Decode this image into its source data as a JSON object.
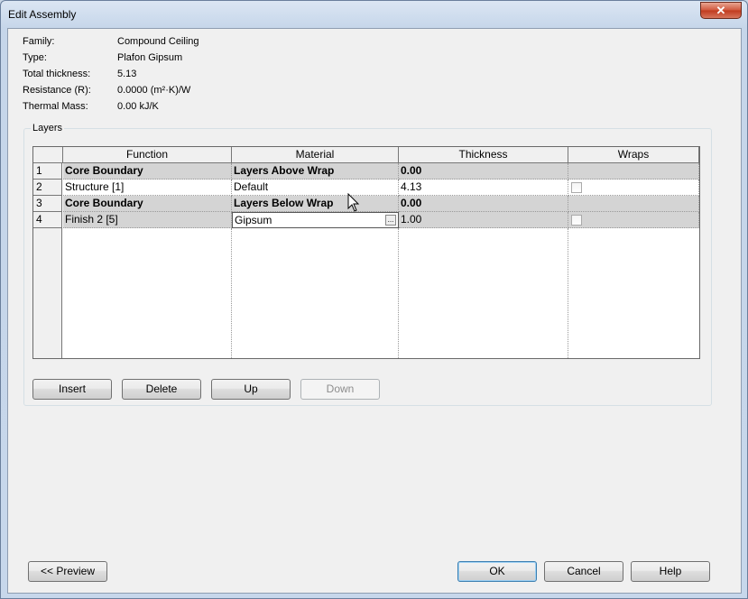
{
  "window": {
    "title": "Edit Assembly",
    "close_glyph": "✕"
  },
  "properties": [
    {
      "label": "Family:",
      "value": "Compound Ceiling"
    },
    {
      "label": "Type:",
      "value": "Plafon Gipsum"
    },
    {
      "label": "Total thickness:",
      "value": "5.13"
    },
    {
      "label": "Resistance (R):",
      "value": "0.0000 (m²·K)/W"
    },
    {
      "label": "Thermal Mass:",
      "value": "0.00 kJ/K"
    }
  ],
  "layers": {
    "group_label": "Layers",
    "columns": [
      "Function",
      "Material",
      "Thickness",
      "Wraps"
    ],
    "rows": [
      {
        "num": "1",
        "function": "Core Boundary",
        "material": "Layers Above Wrap",
        "thickness": "0.00",
        "wraps": null
      },
      {
        "num": "2",
        "function": "Structure [1]",
        "material": "Default",
        "thickness": "4.13",
        "wraps": false
      },
      {
        "num": "3",
        "function": "Core Boundary",
        "material": "Layers Below Wrap",
        "thickness": "0.00",
        "wraps": null
      },
      {
        "num": "4",
        "function": "Finish 2 [5]",
        "material": "Gipsum",
        "thickness": "1.00",
        "wraps": false
      }
    ],
    "ellipsis_glyph": "..."
  },
  "buttons": {
    "insert": "Insert",
    "delete": "Delete",
    "up": "Up",
    "down": "Down",
    "preview": "<< Preview",
    "ok": "OK",
    "cancel": "Cancel",
    "help": "Help"
  }
}
